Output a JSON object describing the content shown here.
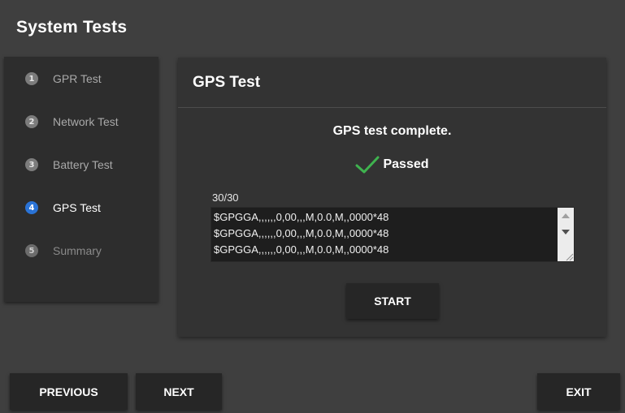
{
  "app": {
    "title": "System Tests"
  },
  "sidebar": {
    "items": [
      {
        "number": "1",
        "label": "GPR Test",
        "state": "done"
      },
      {
        "number": "2",
        "label": "Network Test",
        "state": "done"
      },
      {
        "number": "3",
        "label": "Battery Test",
        "state": "done"
      },
      {
        "number": "4",
        "label": "GPS Test",
        "state": "active"
      },
      {
        "number": "5",
        "label": "Summary",
        "state": "pending"
      }
    ]
  },
  "panel": {
    "title": "GPS Test",
    "status": "GPS test complete.",
    "result_label": "Passed",
    "result_icon": "checkmark-icon",
    "counter": "30/30",
    "log_lines": [
      "$GPGGA,,,,,,0,00,,,M,0.0,M,,0000*48",
      "$GPGGA,,,,,,0,00,,,M,0.0,M,,0000*48",
      "$GPGGA,,,,,,0,00,,,M,0.0,M,,0000*48"
    ],
    "start_label": "START"
  },
  "footer": {
    "previous_label": "PREVIOUS",
    "next_label": "NEXT",
    "exit_label": "EXIT"
  },
  "colors": {
    "background": "#3f3f3f",
    "panel": "#333333",
    "sidebar": "#2d2d2d",
    "button": "#262626",
    "active_step": "#2a73d6",
    "success": "#3fb34f"
  }
}
